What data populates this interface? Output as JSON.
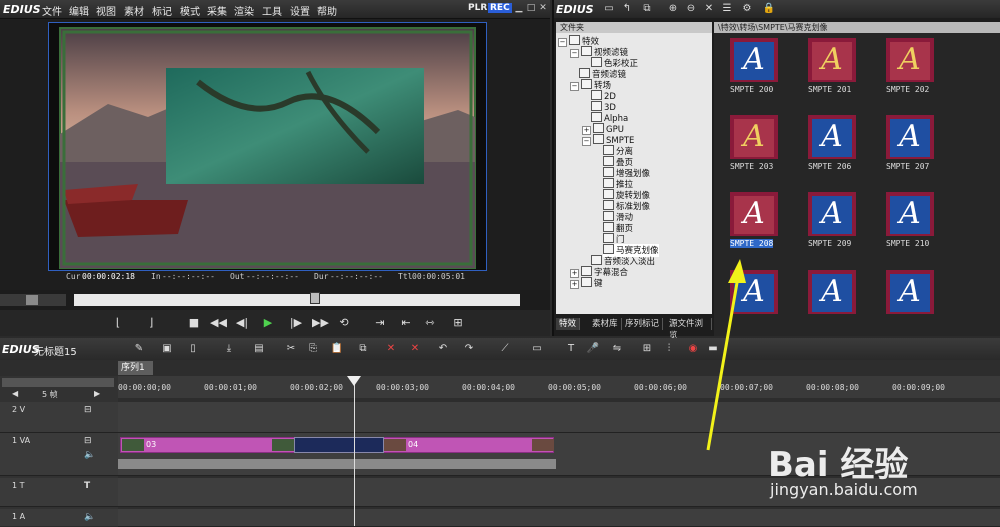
{
  "player": {
    "logo": "EDIUS",
    "menu": [
      "文件",
      "编辑",
      "视图",
      "素材",
      "标记",
      "模式",
      "采集",
      "渲染",
      "工具",
      "设置",
      "帮助"
    ],
    "plr": "PLR",
    "rec": "REC",
    "timecodes": {
      "cur_label": "Cur",
      "cur": "00:00:02:18",
      "in_label": "In",
      "in": "--:--:--:--",
      "out_label": "Out",
      "out": "--:--:--:--",
      "dur_label": "Dur",
      "dur": "--:--:--:--",
      "ttl_label": "Ttl",
      "ttl": "00:00:05:01"
    }
  },
  "effects": {
    "logo": "EDIUS",
    "folder_header": "文件夹",
    "path": "\\特效\\转场\\SMPTE\\马赛克划像",
    "tree": [
      {
        "label": "特效",
        "level": 0,
        "expanded": true
      },
      {
        "label": "视频滤镜",
        "level": 1,
        "expanded": true
      },
      {
        "label": "色彩校正",
        "level": 2
      },
      {
        "label": "音频滤镜",
        "level": 1
      },
      {
        "label": "转场",
        "level": 1,
        "expanded": true
      },
      {
        "label": "2D",
        "level": 2
      },
      {
        "label": "3D",
        "level": 2
      },
      {
        "label": "Alpha",
        "level": 2
      },
      {
        "label": "GPU",
        "level": 2,
        "expandable": true
      },
      {
        "label": "SMPTE",
        "level": 2,
        "expanded": true
      },
      {
        "label": "分离",
        "level": 3
      },
      {
        "label": "叠页",
        "level": 3
      },
      {
        "label": "增强划像",
        "level": 3
      },
      {
        "label": "推拉",
        "level": 3
      },
      {
        "label": "旋转划像",
        "level": 3
      },
      {
        "label": "标准划像",
        "level": 3
      },
      {
        "label": "滑动",
        "level": 3
      },
      {
        "label": "翻页",
        "level": 3
      },
      {
        "label": "门",
        "level": 3
      },
      {
        "label": "马赛克划像",
        "level": 3,
        "selected": true
      },
      {
        "label": "音频淡入淡出",
        "level": 1
      },
      {
        "label": "字幕混合",
        "level": 1,
        "expandable": true
      },
      {
        "label": "键",
        "level": 1,
        "expandable": true
      }
    ],
    "tabs": [
      "特效",
      "素材库",
      "序列标记",
      "源文件浏览"
    ],
    "thumbnails": [
      {
        "label": "SMPTE 200"
      },
      {
        "label": "SMPTE 201"
      },
      {
        "label": "SMPTE 202"
      },
      {
        "label": "SMPTE 203"
      },
      {
        "label": "SMPTE 206"
      },
      {
        "label": "SMPTE 207"
      },
      {
        "label": "SMPTE 208",
        "selected": true
      },
      {
        "label": "SMPTE 209"
      },
      {
        "label": "SMPTE 210"
      },
      {
        "label": ""
      },
      {
        "label": ""
      },
      {
        "label": ""
      }
    ],
    "thumb_letter": "A"
  },
  "timeline": {
    "logo": "EDIUS",
    "project": "无标题15",
    "sequence_tab": "序列1",
    "frames_label": "5 帧",
    "ruler_labels": [
      "00:00:00;00",
      "00:00:01;00",
      "00:00:02;00",
      "00:00:03;00",
      "00:00:04;00",
      "00:00:05;00",
      "00:00:06;00",
      "00:00:07;00",
      "00:00:08;00",
      "00:00:09;00"
    ],
    "tracks": [
      {
        "name": "2 V"
      },
      {
        "name": "1 VA"
      },
      {
        "name": "1 T"
      },
      {
        "name": "1 A"
      }
    ],
    "clip1_label": "03",
    "clip2_label": "04"
  },
  "watermark": {
    "brand": "Bai 经验",
    "url": "jingyan.baidu.com"
  },
  "colors": {
    "accent": "#2a5ed8",
    "clip": "#c055b5",
    "arrow": "#f2f21a"
  }
}
